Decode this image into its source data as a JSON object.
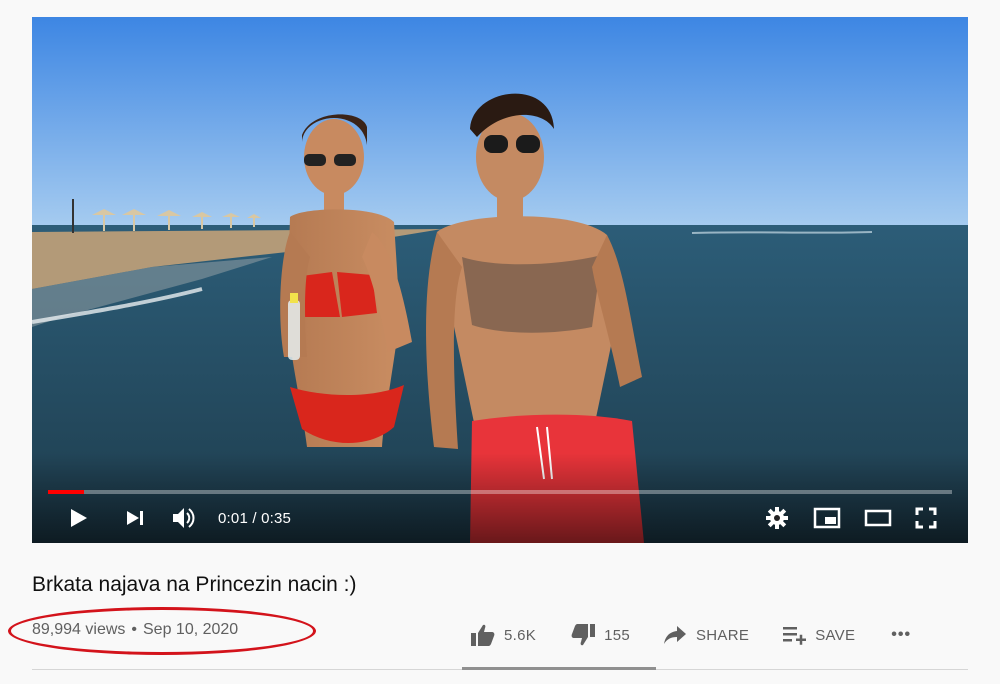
{
  "video": {
    "title": "Brkata najava na Princezin nacin :)",
    "views": "89,994 views",
    "separator": "•",
    "date": "Sep 10, 2020",
    "progress_fraction": 0.04
  },
  "player": {
    "time_current": "0:01",
    "time_separator": " / ",
    "time_total": "0:35",
    "icons": [
      "play-icon",
      "next-icon",
      "volume-icon",
      "settings-icon",
      "miniplayer-icon",
      "theater-icon",
      "fullscreen-icon"
    ]
  },
  "actions": {
    "likes": "5.6K",
    "dislikes": "155",
    "share": "SHARE",
    "save": "SAVE",
    "more": "•••"
  },
  "colors": {
    "progress": "#ff0000",
    "annotation": "#d3131b",
    "text_primary": "#111111",
    "text_secondary": "#606060",
    "background": "#f9f9f9"
  }
}
